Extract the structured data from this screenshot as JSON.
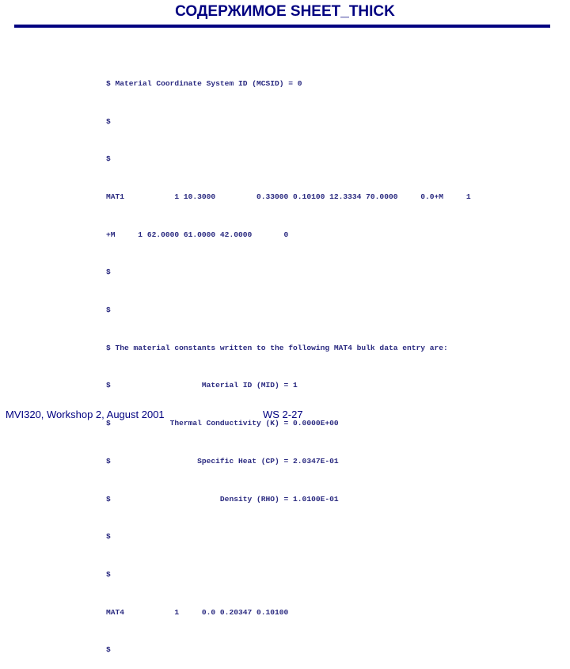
{
  "slide": {
    "title": "СОДЕРЖИМОЕ SHEET_THICK",
    "accent_color": "#000080"
  },
  "code_lines": [
    "$ Material Coordinate System ID (MCSID) = 0",
    "$",
    "$",
    "MAT1           1 10.3000         0.33000 0.10100 12.3334 70.0000     0.0+M     1",
    "+M     1 62.0000 61.0000 42.0000       0",
    "$",
    "$",
    "$ The material constants written to the following MAT4 bulk data entry are:",
    "$                    Material ID (MID) = 1",
    "$             Thermal Conductivity (K) = 0.0000E+00",
    "$                   Specific Heat (CP) = 2.0347E-01",
    "$                        Density (RHO) = 1.0100E-01",
    "$",
    "$",
    "MAT4           1     0.0 0.20347 0.10100",
    "$"
  ],
  "footer": {
    "left": "MVI320, Workshop 2, August 2001",
    "right": "WS 2-27"
  }
}
